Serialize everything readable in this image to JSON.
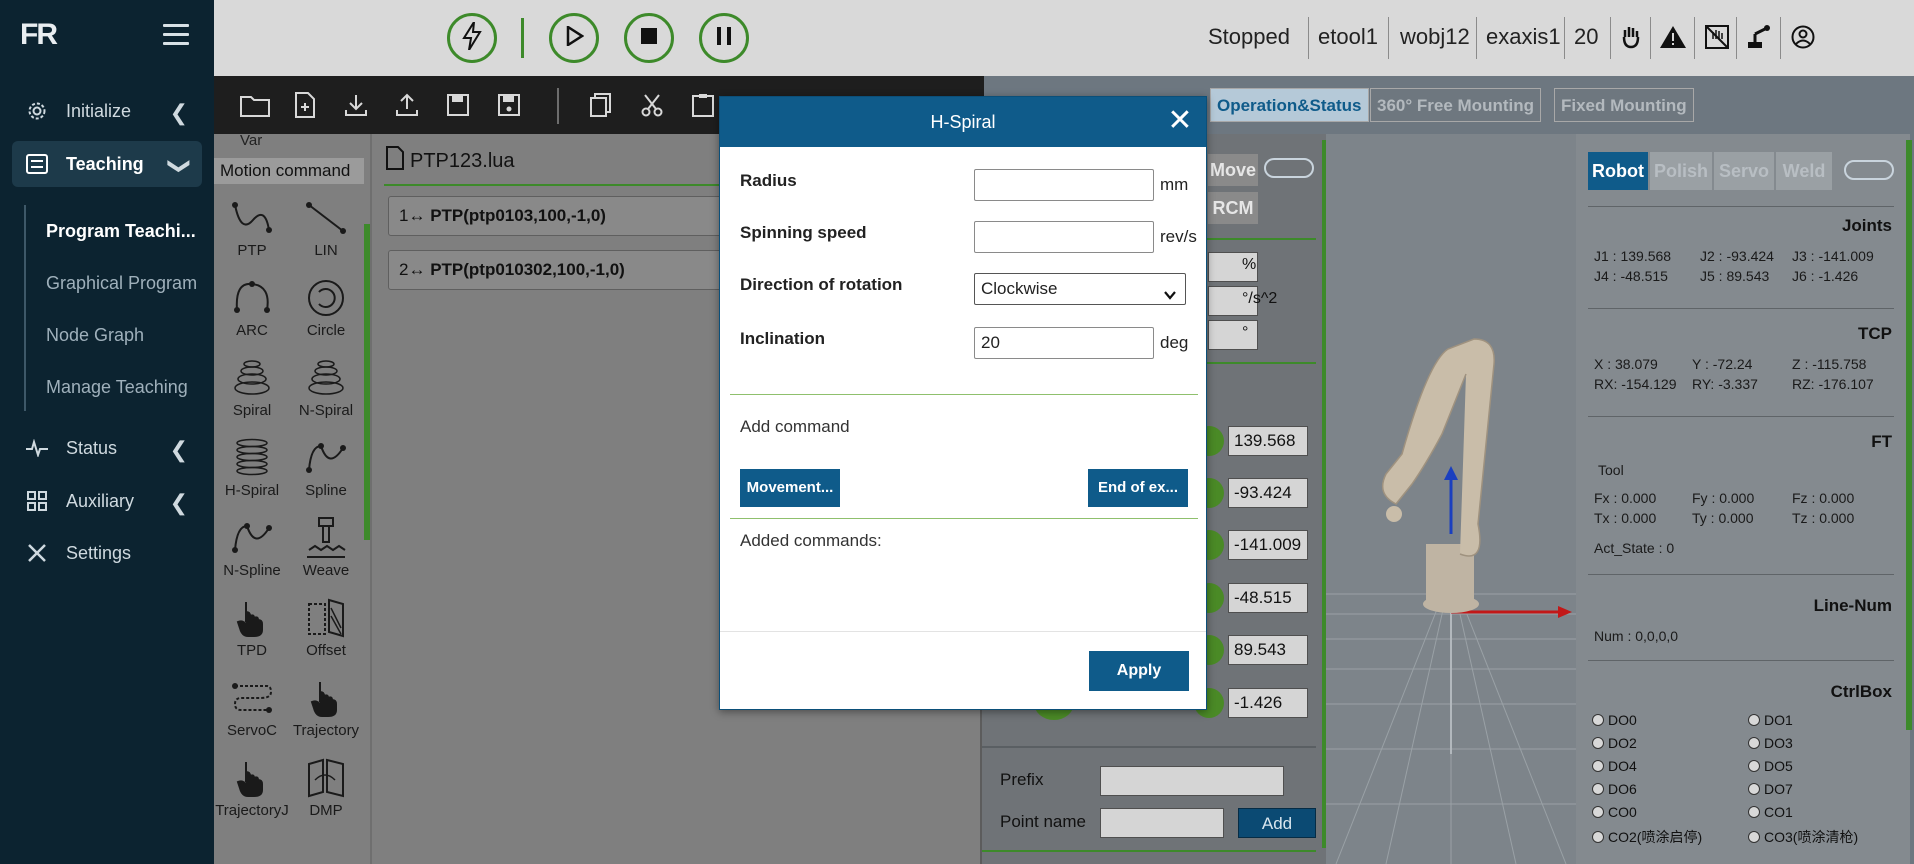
{
  "app": {
    "logo_text": "FR"
  },
  "sidebar": {
    "items": [
      {
        "label": "Initialize",
        "icon": "gear-icon"
      },
      {
        "label": "Teaching",
        "icon": "list-icon"
      },
      {
        "label": "Status",
        "icon": "pulse-icon"
      },
      {
        "label": "Auxiliary",
        "icon": "grid-icon"
      },
      {
        "label": "Settings",
        "icon": "tools-icon"
      }
    ],
    "teaching_sub": [
      "Program Teachi...",
      "Graphical Program",
      "Node Graph",
      "Manage Teaching"
    ]
  },
  "topbar": {
    "state": "Stopped",
    "tool": "etool1",
    "workobj": "wobj12",
    "exaxis": "exaxis1",
    "speed": "20"
  },
  "commands": {
    "var_label": "Var",
    "section_title": "Motion command",
    "items": [
      "PTP",
      "LIN",
      "ARC",
      "Circle",
      "Spiral",
      "N-Spiral",
      "H-Spiral",
      "Spline",
      "N-Spline",
      "Weave",
      "TPD",
      "Offset",
      "ServoC",
      "Trajectory",
      "TrajectoryJ",
      "DMP"
    ]
  },
  "editor": {
    "filename": "PTP123.lua",
    "lines": [
      {
        "num": "1",
        "code": "PTP(ptp0103,100,-1,0)"
      },
      {
        "num": "2",
        "code": "PTP(ptp010302,100,-1,0)"
      }
    ]
  },
  "view_tabs": [
    "Operation&Status",
    "360° Free Mounting",
    "Fixed Mounting"
  ],
  "jog": {
    "move_label": "Move",
    "rcm_label": "RCM",
    "units": [
      "%",
      "°/s^2",
      "°"
    ],
    "values": [
      "139.568",
      "-93.424",
      "-141.009",
      "-48.515",
      "89.543",
      "-1.426"
    ],
    "prefix_label": "Prefix",
    "point_name_label": "Point name",
    "add_label": "Add"
  },
  "info": {
    "tabs": [
      "Robot",
      "Polish",
      "Servo",
      "Weld"
    ],
    "joints_title": "Joints",
    "joints": [
      "J1 : 139.568",
      "J2 : -93.424",
      "J3 : -141.009",
      "J4 : -48.515",
      "J5 : 89.543",
      "J6 : -1.426"
    ],
    "tcp_title": "TCP",
    "tcp": [
      "X   : 38.079",
      "Y   : -72.24",
      "Z   : -115.758",
      "RX: -154.129",
      "RY: -3.337",
      "RZ: -176.107"
    ],
    "ft_title": "FT",
    "ft_tool": "Tool",
    "ft": [
      "Fx : 0.000",
      "Fy : 0.000",
      "Fz : 0.000",
      "Tx : 0.000",
      "Ty : 0.000",
      "Tz : 0.000"
    ],
    "act_state": "Act_State  :     0",
    "linenum_title": "Line-Num",
    "linenum": "Num       :   0,0,0,0",
    "ctrlbox_title": "CtrlBox",
    "ctrlbox": [
      "DO0",
      "DO1",
      "DO2",
      "DO3",
      "DO4",
      "DO5",
      "DO6",
      "DO7",
      "CO0",
      "CO1",
      "CO2(喷涂启停)",
      "CO3(喷涂清枪)"
    ]
  },
  "modal": {
    "title": "H-Spiral",
    "radius_label": "Radius",
    "radius_value": "",
    "radius_unit": "mm",
    "speed_label": "Spinning speed",
    "speed_value": "",
    "speed_unit": "rev/s",
    "direction_label": "Direction of rotation",
    "direction_value": "Clockwise",
    "inclination_label": "Inclination",
    "inclination_value": "20",
    "inclination_unit": "deg",
    "add_command_label": "Add command",
    "movement_btn": "Movement...",
    "end_btn": "End of ex...",
    "added_commands_label": "Added commands:",
    "apply_label": "Apply"
  },
  "colors": {
    "primary": "#0f5b8a",
    "sidebar": "#0c2330",
    "accent_green": "#3d8a2a"
  }
}
